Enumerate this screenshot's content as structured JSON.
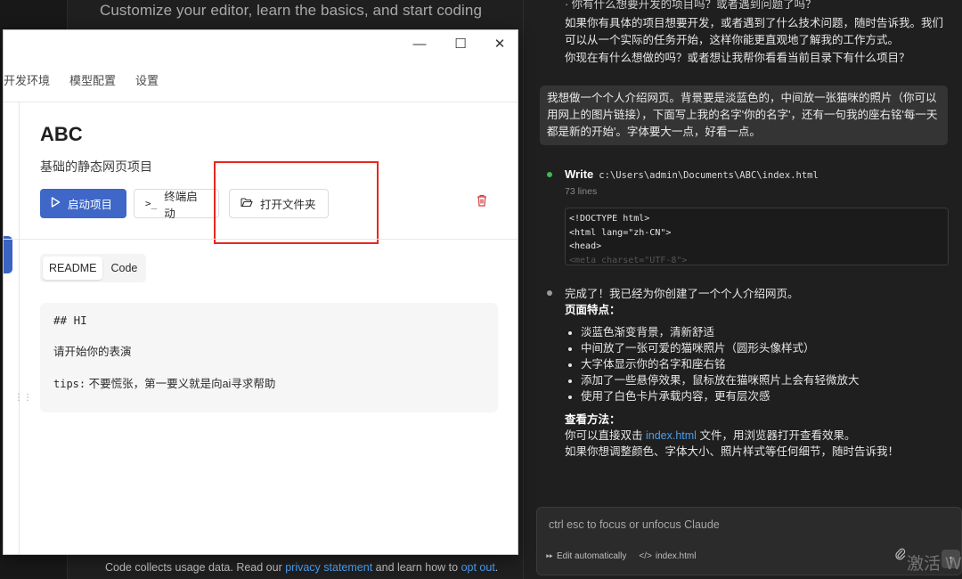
{
  "background": {
    "welcome_text": "Customize your editor, learn the basics, and start coding",
    "footer_prefix": "Code collects usage data. Read our ",
    "footer_link1": "privacy statement",
    "footer_middle": " and learn how to ",
    "footer_link2": "opt out",
    "footer_suffix": "."
  },
  "window": {
    "controls": {
      "minimize": "—",
      "maximize": "☐",
      "close": "✕"
    },
    "menu": [
      "开发环境",
      "模型配置",
      "设置"
    ],
    "project": {
      "name": "ABC",
      "description": "基础的静态网页项目"
    },
    "actions": {
      "start": "启动项目",
      "terminal": "终端启动",
      "open_folder": "打开文件夹"
    },
    "tabs": [
      "README",
      "Code"
    ],
    "active_tab": "README",
    "readme": {
      "heading": "## HI",
      "line1": "请开始你的表演",
      "tips_label": "tips:",
      "tips_text": " 不要慌张，第一要义就是向ai寻求帮助"
    }
  },
  "chat": {
    "cut_line": "· 你有什么想要开发的项目吗？或者遇到问题了吗？",
    "assistant_para1": "如果你有具体的项目想要开发，或者遇到了什么技术问题，随时告诉我。我们可以从一个实际的任务开始，这样你能更直观地了解我的工作方式。",
    "assistant_para2": "你现在有什么想做的吗？或者想让我帮你看看当前目录下有什么项目？",
    "user_message": "我想做一个个人介绍网页。背景要是淡蓝色的，中间放一张猫咪的照片（你可以用网上的图片链接），下面写上我的名字'你的名字'，还有一句我的座右铭'每一天都是新的开始'。字体要大一点，好看一点。",
    "write_tool": {
      "label": "Write",
      "path": "c:\\Users\\admin\\Documents\\ABC\\index.html",
      "lines": "73 lines",
      "code": [
        "<!DOCTYPE html>",
        "<html lang=\"zh-CN\">",
        "<head>",
        "    <meta charset=\"UTF-8\">"
      ]
    },
    "result": {
      "intro": "完成了！我已经为你创建了一个个人介绍网页。",
      "features_title": "页面特点：",
      "features": [
        "淡蓝色渐变背景，清新舒适",
        "中间放了一张可爱的猫咪照片（圆形头像样式）",
        "大字体显示你的名字和座右铭",
        "添加了一些悬停效果，鼠标放在猫咪照片上会有轻微放大",
        "使用了白色卡片承载内容，更有层次感"
      ],
      "howto_title": "查看方法：",
      "howto_prefix": "你可以直接双击 ",
      "howto_link": "index.html",
      "howto_suffix": " 文件，用浏览器打开查看效果。",
      "closing": "如果你想调整颜色、字体大小、照片样式等任何细节，随时告诉我！"
    },
    "input": {
      "placeholder": "ctrl esc to focus or unfocus Claude",
      "edit_mode": "Edit automatically",
      "file_ref": "index.html"
    },
    "watermark": "激活 W"
  },
  "colors": {
    "accent": "#3e67c7",
    "highlight_box": "#e8261f",
    "link": "#4a9ef0",
    "danger": "#d63a3a"
  }
}
